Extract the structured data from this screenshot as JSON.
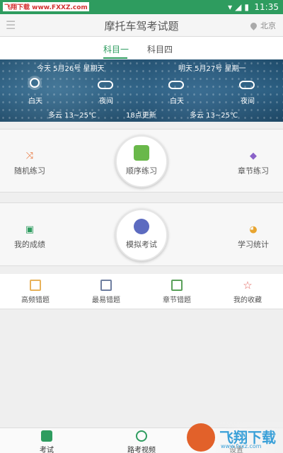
{
  "status_bar": {
    "watermark": "飞翔下载 www.FXXZ.com",
    "icons": "▾◢▮",
    "time": "11:35"
  },
  "app_bar": {
    "title": "摩托车驾考试题",
    "location": "北京",
    "menu_icon": "menu-icon"
  },
  "tabs": [
    {
      "label": "科目一",
      "active": true
    },
    {
      "label": "科目四",
      "active": false
    }
  ],
  "weather": {
    "today_header": "今天 5月26号 星期天",
    "tomorrow_header": "明天 5月27号 星期一",
    "today": {
      "day_label": "白天",
      "night_label": "夜间",
      "summary": "多云 13~25℃"
    },
    "tomorrow": {
      "day_label": "白天",
      "night_label": "夜间",
      "summary": "多云 13~25℃"
    },
    "update": "18点更新"
  },
  "practice": {
    "random": "随机练习",
    "sequential": "顺序练习",
    "chapter": "章节练习"
  },
  "exam": {
    "my_score": "我的成绩",
    "mock": "模拟考试",
    "stats": "学习统计"
  },
  "quick_links": [
    {
      "label": "高频错题",
      "icon": "calendar-icon",
      "color": "#e8b25a"
    },
    {
      "label": "最易错题",
      "icon": "book-icon",
      "color": "#6f7fa0"
    },
    {
      "label": "章节错题",
      "icon": "calendar-check-icon",
      "color": "#5aa05a"
    },
    {
      "label": "我的收藏",
      "icon": "star-icon",
      "color": "#e0605a"
    }
  ],
  "bottom_nav": [
    {
      "label": "考试",
      "icon": "clipboard-icon",
      "color": "#2e9c5f"
    },
    {
      "label": "路考视频",
      "icon": "video-icon",
      "color": "#2e9c5f"
    },
    {
      "label": "设置",
      "icon": "gear-icon",
      "color": "#2e9c5f"
    }
  ],
  "brand": {
    "name": "飞翔下载",
    "url": "www.fxxz.com"
  },
  "colors": {
    "accent": "#2e9c5f"
  }
}
